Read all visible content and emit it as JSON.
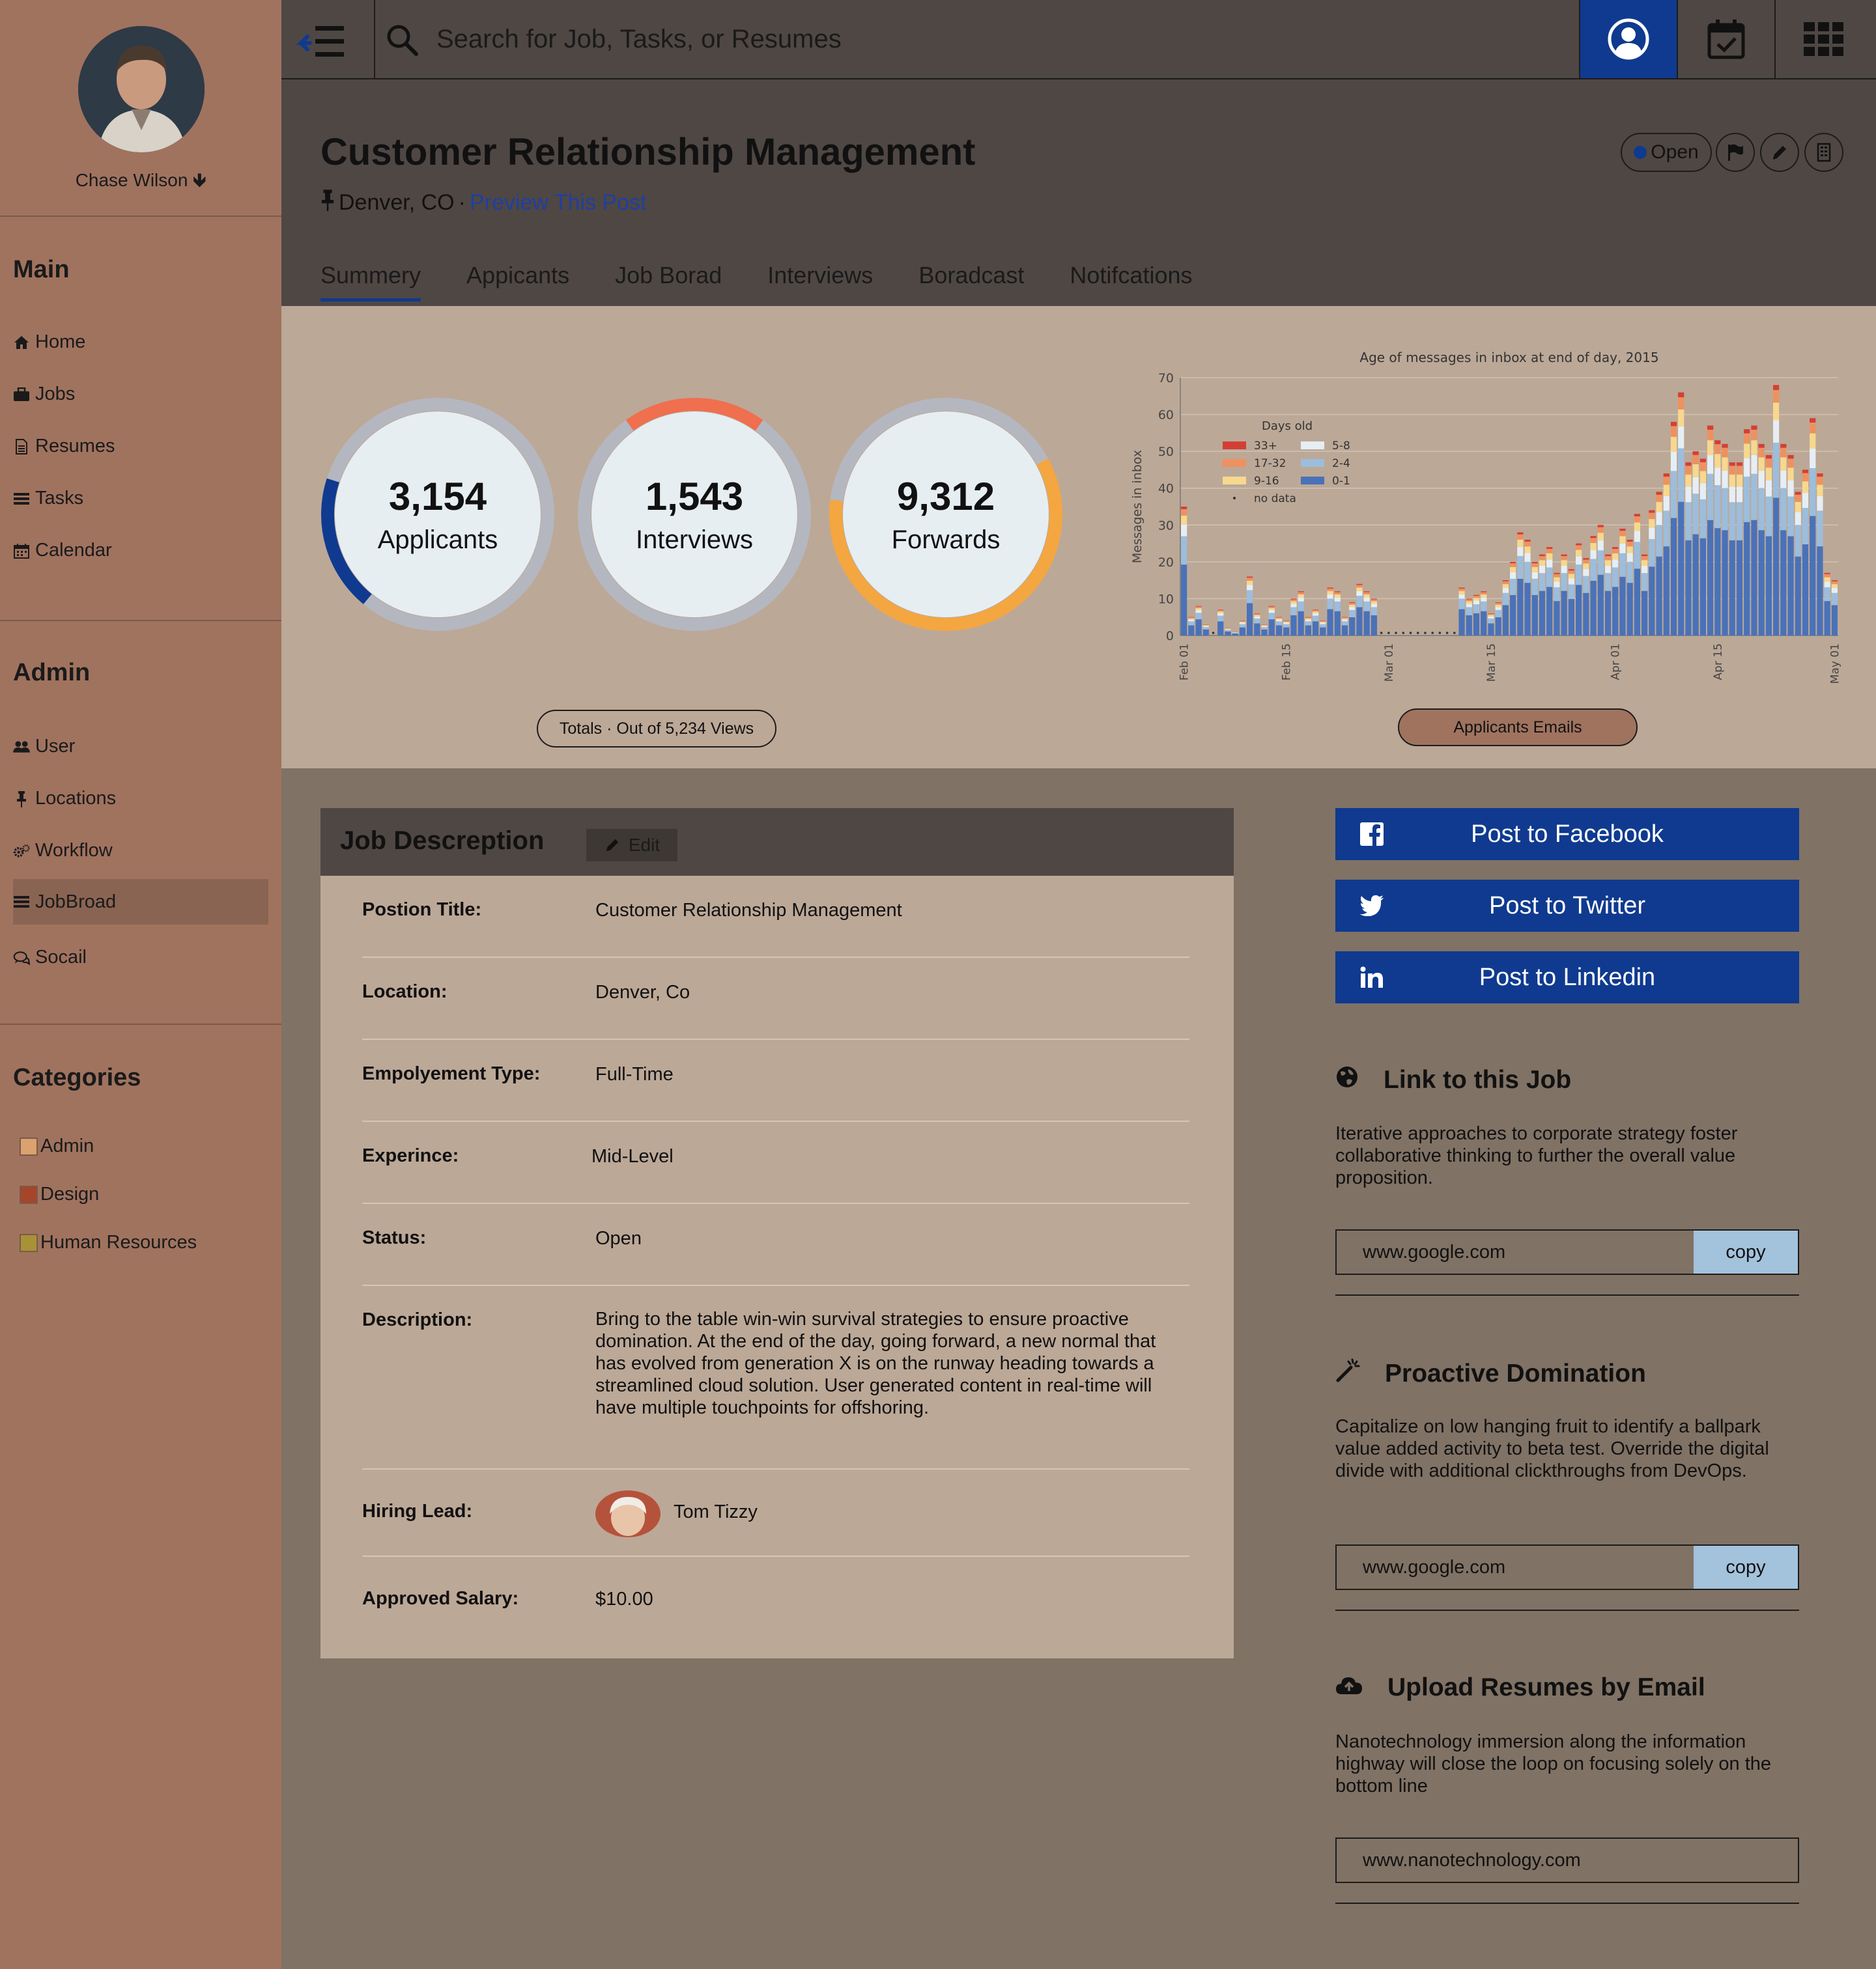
{
  "user": {
    "name": "Chase Wilson"
  },
  "search": {
    "placeholder": "Search for Job, Tasks, or Resumes"
  },
  "sidebar": {
    "main_title": "Main",
    "main_items": [
      "Home",
      "Jobs",
      "Resumes",
      "Tasks",
      "Calendar"
    ],
    "admin_title": "Admin",
    "admin_items": [
      "User",
      "Locations",
      "Workflow",
      "JobBroad",
      "Socail"
    ],
    "active_item": "JobBroad",
    "categories_title": "Categories",
    "categories": [
      {
        "label": "Admin",
        "color": "#d9a26e"
      },
      {
        "label": "Design",
        "color": "#a6452a"
      },
      {
        "label": "Human Resources",
        "color": "#a89235"
      }
    ]
  },
  "header": {
    "title": "Customer Relationship Management",
    "location": "Denver, CO",
    "separator": "·",
    "preview_link": "Preview This Post",
    "status_badge": "Open",
    "tabs": [
      "Summery",
      "Appicants",
      "Job Borad",
      "Interviews",
      "Boradcast",
      "Notifcations"
    ],
    "active_tab": "Summery"
  },
  "stats": {
    "applicants": {
      "value": "3,154",
      "label": "Applicants",
      "fraction": 0.19,
      "color": "#0f3a8f"
    },
    "interviews": {
      "value": "1,543",
      "label": "Interviews",
      "fraction": 0.2,
      "color": "#ef6f4f"
    },
    "forwards": {
      "value": "9,312",
      "label": "Forwards",
      "fraction": 0.6,
      "color": "#f4a640"
    },
    "totals_pill": "Totals · Out of 5,234 Views",
    "emails_pill": "Applicants Emails"
  },
  "chart_data": {
    "type": "bar",
    "stacked": true,
    "title": "Age of messages in inbox at end of day, 2015",
    "ylabel": "Messages in inbox",
    "xlabel": "",
    "ylim": [
      0,
      70
    ],
    "yticks": [
      0,
      10,
      20,
      30,
      40,
      50,
      60,
      70
    ],
    "xtick_labels": [
      "Feb 01",
      "Feb 15",
      "Mar 01",
      "Mar 15",
      "Apr 01",
      "Apr 15",
      "May 01"
    ],
    "grid": true,
    "legend_title": "Days old",
    "legend_position": "top-left",
    "series": [
      {
        "name": "33+",
        "color": "#d33f35"
      },
      {
        "name": "17-32",
        "color": "#ee9161"
      },
      {
        "name": "9-16",
        "color": "#f7d88e"
      },
      {
        "name": "5-8",
        "color": "#e6eef5"
      },
      {
        "name": "2-4",
        "color": "#9dbddc"
      },
      {
        "name": "0-1",
        "color": "#4a72b8"
      },
      {
        "name": "no data",
        "color": "#333333"
      }
    ],
    "totals": [
      35,
      5,
      8,
      3,
      0,
      7,
      2,
      1,
      4,
      16,
      6,
      3,
      8,
      5,
      4,
      10,
      12,
      5,
      7,
      4,
      13,
      12,
      5,
      9,
      14,
      12,
      10,
      0,
      0,
      0,
      0,
      0,
      0,
      0,
      0,
      0,
      0,
      0,
      13,
      10,
      11,
      12,
      6,
      9,
      15,
      20,
      28,
      26,
      20,
      22,
      24,
      17,
      22,
      18,
      25,
      21,
      27,
      30,
      22,
      24,
      29,
      26,
      33,
      22,
      34,
      39,
      44,
      58,
      66,
      47,
      50,
      48,
      57,
      53,
      52,
      47,
      47,
      56,
      57,
      52,
      49,
      68,
      52,
      49,
      39,
      45,
      59,
      44,
      17,
      15
    ]
  },
  "job_description": {
    "title": "Job Descreption",
    "edit_label": "Edit",
    "rows": [
      {
        "label": "Postion Title:",
        "value": "Customer Relationship Management"
      },
      {
        "label": "Location:",
        "value": "Denver, Co"
      },
      {
        "label": "Empolyement Type:",
        "value": "Full-Time"
      },
      {
        "label": "Experince:",
        "value": "Mid-Level"
      },
      {
        "label": "Status:",
        "value": "Open"
      },
      {
        "label": "Description:",
        "value": "Bring to the table win-win survival strategies to ensure proactive domination. At the end of the day, going forward, a new normal that has evolved from generation X is on the runway heading towards a streamlined cloud solution. User generated content in real-time will have multiple touchpoints for offshoring."
      },
      {
        "label": "Hiring Lead:",
        "value": "Tom Tizzy"
      },
      {
        "label": "Approved Salary:",
        "value": "$10.00"
      }
    ]
  },
  "social": {
    "facebook": "Post to Facebook",
    "twitter": "Post to Twitter",
    "linkedin": "Post to Linkedin"
  },
  "link_job": {
    "title": "Link to this Job",
    "text": "Iterative approaches to corporate strategy foster collaborative thinking to further the overall value proposition.",
    "url": "www.google.com",
    "copy": "copy"
  },
  "proactive": {
    "title": "Proactive Domination",
    "text": "Capitalize on low hanging fruit to identify a ballpark value added activity to beta test. Override the digital divide with additional clickthroughs from DevOps.",
    "url": "www.google.com",
    "copy": "copy"
  },
  "upload": {
    "title": "Upload Resumes by Email",
    "text": "Nanotechnology immersion along the information highway will close the loop on focusing solely on the bottom line",
    "url": "www.nanotechnology.com"
  }
}
